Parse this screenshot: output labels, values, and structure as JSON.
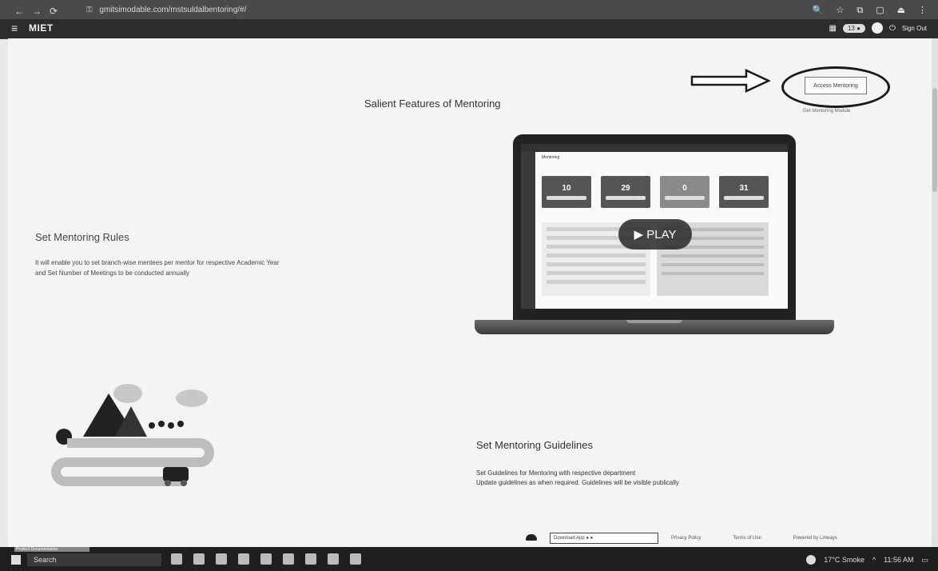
{
  "browser": {
    "url": "gmitsimodable.com/mstsuldalbentoring/#/",
    "nav_icons": [
      "←",
      "→",
      "⟳"
    ],
    "right_icons": [
      "🔍",
      "☆",
      "⧉",
      "▢",
      "⏏",
      "⋮"
    ]
  },
  "appbar": {
    "menu_icon": "≡",
    "title": "MIET",
    "pill": "13 ●",
    "signout": "Sign Out"
  },
  "page": {
    "title": "Salient Features of Mentoring",
    "access_button": "Access Mentoring",
    "access_caption": "Get Mentoring Module",
    "section1": {
      "title": "Set Mentoring Rules",
      "description": "It will enable you to set branch-wise mentees per mentor for respective Academic Year and Set Number of Meetings to be conducted annually"
    },
    "video": {
      "play_label": "▶ PLAY",
      "heading": "Mentoring",
      "tiles": [
        "10",
        "29",
        "0",
        "31"
      ]
    },
    "section2": {
      "title": "Set Mentoring Guidelines",
      "line1": "Set Guidelines for Mentoring with respective department",
      "line2": "Update guidelines as when required. Guidelines will be visible publically"
    },
    "footer": {
      "download": "Download App ● ●",
      "privacy": "Privacy Policy",
      "terms": "Terms of Use",
      "powered": "Powered by Linways"
    }
  },
  "taskbar": {
    "tooltip": "Product Documentation",
    "search": "Search",
    "weather": "17°C Smoke",
    "time": "11:56 AM"
  }
}
